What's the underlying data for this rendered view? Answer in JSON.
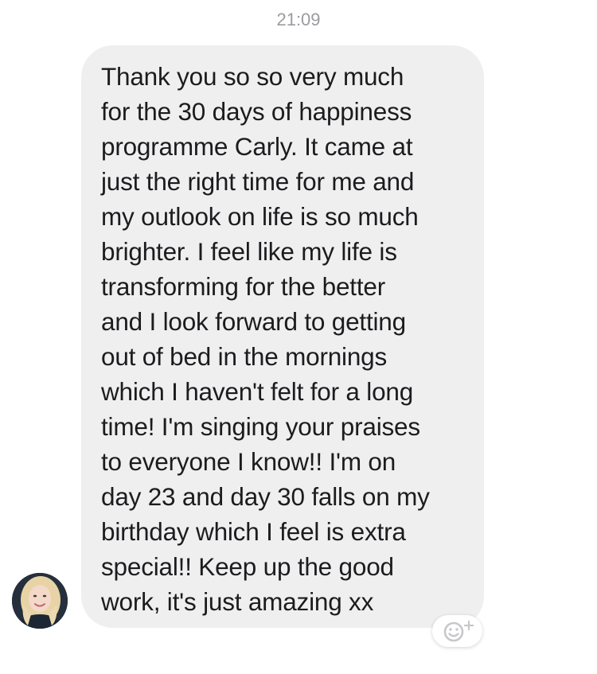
{
  "timestamp": "21:09",
  "message": {
    "lines": [
      "Thank you so so very much",
      "for the 30 days of happiness",
      "programme Carly. It came at",
      "just the right time for me and",
      "my outlook on life is so much",
      "brighter. I feel like my life is",
      "transforming for the better",
      "and I look forward to getting",
      "out of bed in the mornings",
      "which I haven't felt for a long",
      "time! I'm singing your praises",
      "to everyone I know!! I'm on",
      "day 23 and day 30 falls on my",
      "birthday which I feel is extra",
      "special!! Keep up the good",
      "work, it's just amazing xx"
    ]
  },
  "icons": {
    "avatar": "user-avatar-photo",
    "reaction": "add-reaction-smiley-icon"
  },
  "colors": {
    "bubble_background": "#efeff0",
    "text": "#1c1c1e",
    "timestamp": "#9b9ba0",
    "reaction_icon": "#c7c7cc"
  }
}
